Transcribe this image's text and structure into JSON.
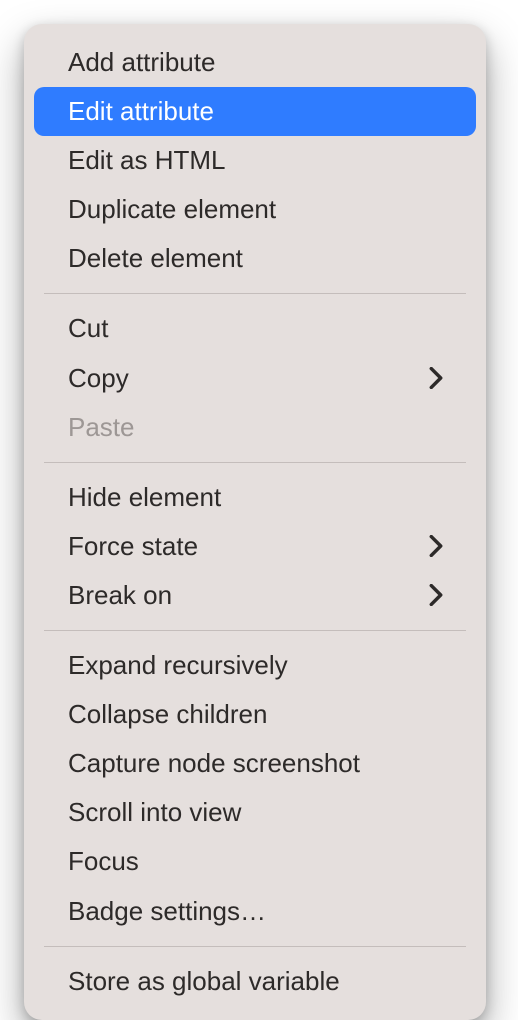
{
  "menu": {
    "groups": [
      [
        {
          "id": "add-attribute",
          "label": "Add attribute",
          "submenu": false,
          "disabled": false,
          "highlighted": false
        },
        {
          "id": "edit-attribute",
          "label": "Edit attribute",
          "submenu": false,
          "disabled": false,
          "highlighted": true
        },
        {
          "id": "edit-as-html",
          "label": "Edit as HTML",
          "submenu": false,
          "disabled": false,
          "highlighted": false
        },
        {
          "id": "duplicate-element",
          "label": "Duplicate element",
          "submenu": false,
          "disabled": false,
          "highlighted": false
        },
        {
          "id": "delete-element",
          "label": "Delete element",
          "submenu": false,
          "disabled": false,
          "highlighted": false
        }
      ],
      [
        {
          "id": "cut",
          "label": "Cut",
          "submenu": false,
          "disabled": false,
          "highlighted": false
        },
        {
          "id": "copy",
          "label": "Copy",
          "submenu": true,
          "disabled": false,
          "highlighted": false
        },
        {
          "id": "paste",
          "label": "Paste",
          "submenu": false,
          "disabled": true,
          "highlighted": false
        }
      ],
      [
        {
          "id": "hide-element",
          "label": "Hide element",
          "submenu": false,
          "disabled": false,
          "highlighted": false
        },
        {
          "id": "force-state",
          "label": "Force state",
          "submenu": true,
          "disabled": false,
          "highlighted": false
        },
        {
          "id": "break-on",
          "label": "Break on",
          "submenu": true,
          "disabled": false,
          "highlighted": false
        }
      ],
      [
        {
          "id": "expand-recursively",
          "label": "Expand recursively",
          "submenu": false,
          "disabled": false,
          "highlighted": false
        },
        {
          "id": "collapse-children",
          "label": "Collapse children",
          "submenu": false,
          "disabled": false,
          "highlighted": false
        },
        {
          "id": "capture-node-screenshot",
          "label": "Capture node screenshot",
          "submenu": false,
          "disabled": false,
          "highlighted": false
        },
        {
          "id": "scroll-into-view",
          "label": "Scroll into view",
          "submenu": false,
          "disabled": false,
          "highlighted": false
        },
        {
          "id": "focus",
          "label": "Focus",
          "submenu": false,
          "disabled": false,
          "highlighted": false
        },
        {
          "id": "badge-settings",
          "label": "Badge settings…",
          "submenu": false,
          "disabled": false,
          "highlighted": false
        }
      ],
      [
        {
          "id": "store-as-global-variable",
          "label": "Store as global variable",
          "submenu": false,
          "disabled": false,
          "highlighted": false
        }
      ]
    ]
  }
}
